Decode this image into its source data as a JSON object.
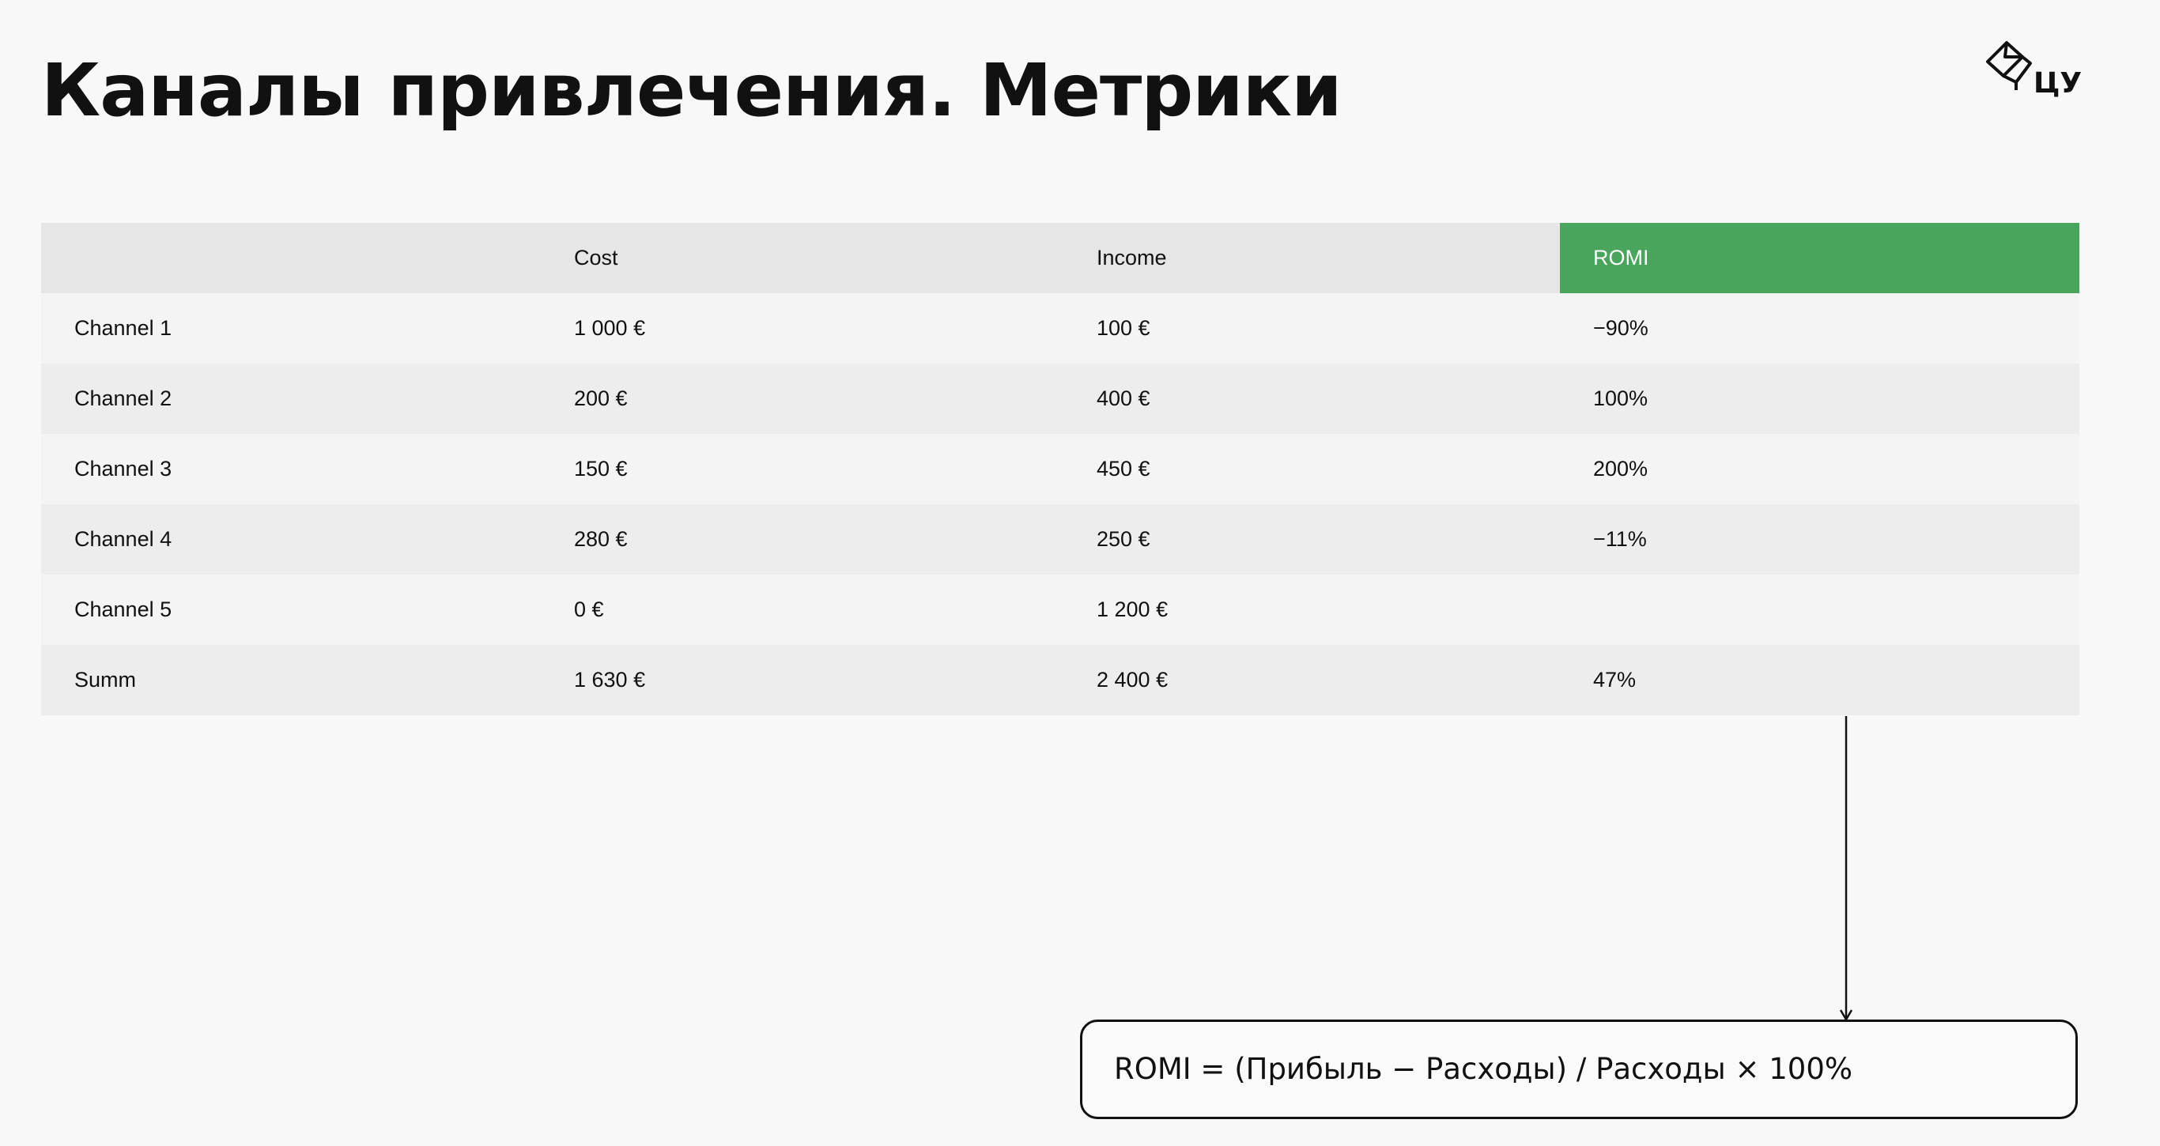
{
  "title": "Каналы привлечения. Метрики",
  "logo": {
    "text": "ЦУ",
    "icon": "cube-logo-icon"
  },
  "table": {
    "headers": [
      "",
      "Cost",
      "Income",
      "ROMI"
    ],
    "rows": [
      [
        "Channel 1",
        "1 000 €",
        "100 €",
        "−90%"
      ],
      [
        "Channel 2",
        "200 €",
        "400 €",
        "100%"
      ],
      [
        "Channel 3",
        "150 €",
        "450 €",
        "200%"
      ],
      [
        "Channel 4",
        "280 €",
        "250 €",
        "−11%"
      ],
      [
        "Channel 5",
        "0 €",
        "1 200 €",
        ""
      ],
      [
        "Summ",
        "1 630 €",
        "2 400 €",
        "47%"
      ]
    ]
  },
  "formula": "ROMI = (Прибыль − Расходы) / Расходы × 100%",
  "colors": {
    "accent": "#49a55b",
    "header_bg": "#e6e6e6",
    "row_light": "#f4f4f4",
    "row_dark": "#ededed",
    "background": "#f8f8f8"
  }
}
